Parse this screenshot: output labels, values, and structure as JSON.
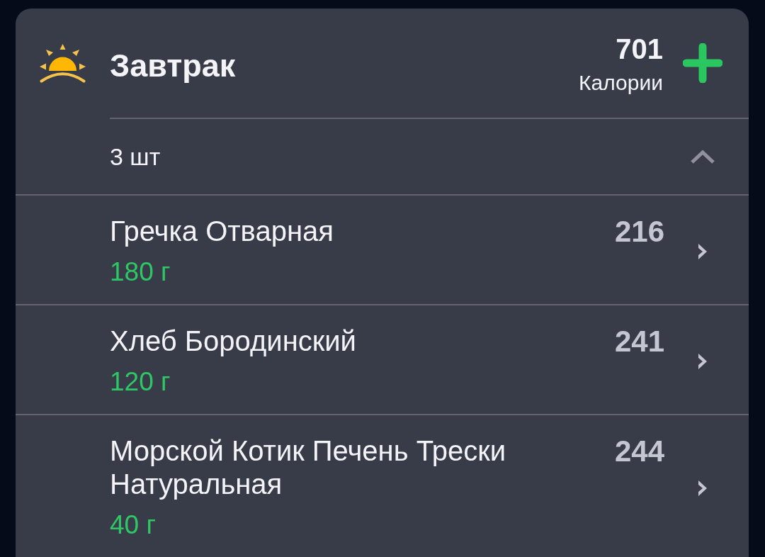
{
  "meal": {
    "title": "Завтрак",
    "calories": "701",
    "calories_label": "Калории"
  },
  "summary": {
    "count": "3 шт",
    "expanded": true
  },
  "items": [
    {
      "name": "Гречка Отварная",
      "amount": "180 г",
      "calories": "216"
    },
    {
      "name": "Хлеб Бородинский",
      "amount": "120 г",
      "calories": "241"
    },
    {
      "name": "Морской Котик Печень Трески Натуральная",
      "amount": "40 г",
      "calories": "244"
    }
  ]
}
